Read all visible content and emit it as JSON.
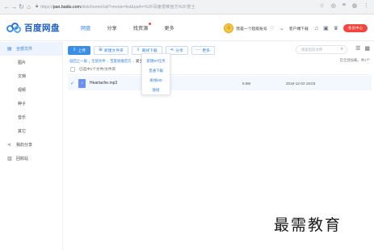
{
  "browser": {
    "url_scheme": "https://",
    "url_host": "pan.baidu.com",
    "url_path": "/disk/home#/all?vmode=list&path=%2F百度很难官方%2F爱士"
  },
  "header": {
    "logo_text": "百度网盘",
    "nav": [
      {
        "label": "网盘",
        "active": true
      },
      {
        "label": "分享",
        "active": false
      },
      {
        "label": "找资源",
        "active": false,
        "dot": true
      },
      {
        "label": "更多",
        "active": false
      }
    ],
    "username": "我是一个超级账号",
    "client_download": "客户端下载",
    "member_button": "会员中心"
  },
  "sidebar": {
    "items": [
      {
        "label": "全部文件",
        "icon": "folder-icon",
        "glyph": "▤",
        "active": true,
        "top": true
      },
      {
        "label": "图片"
      },
      {
        "label": "文档"
      },
      {
        "label": "视频"
      },
      {
        "label": "种子"
      },
      {
        "label": "音乐"
      },
      {
        "label": "其它"
      },
      {
        "label": "我的分享",
        "icon": "share-icon",
        "glyph": "⋖",
        "top": true
      },
      {
        "label": "回收站",
        "icon": "trash-icon",
        "glyph": "▥",
        "top": true
      }
    ]
  },
  "toolbar": {
    "upload": "上传",
    "new_folder": "新建文件夹",
    "offline_download": "离线下载",
    "share": "分享",
    "more": "更多",
    "search_placeholder": "搜索您的文件"
  },
  "breadcrumb": {
    "items": [
      "返回上一级",
      "全部文件",
      "百度很难官方",
      "爱士"
    ],
    "loaded_text": "已全部加载，共1个"
  },
  "list": {
    "select_all_label": "已选中1个文件/文件夹",
    "files": [
      {
        "name": "Heartache.mp3",
        "size": "5.9M",
        "date": "2018-12-02 18:03",
        "checked": true
      }
    ]
  },
  "dropdown": {
    "items": [
      "新建BT任务",
      "普通下载",
      "离线MD",
      "链接"
    ]
  },
  "watermark": "最需教育",
  "colors": {
    "accent": "#2f7fe0",
    "member_red": "#f2453d",
    "selected_row": "#f3f8fe"
  }
}
